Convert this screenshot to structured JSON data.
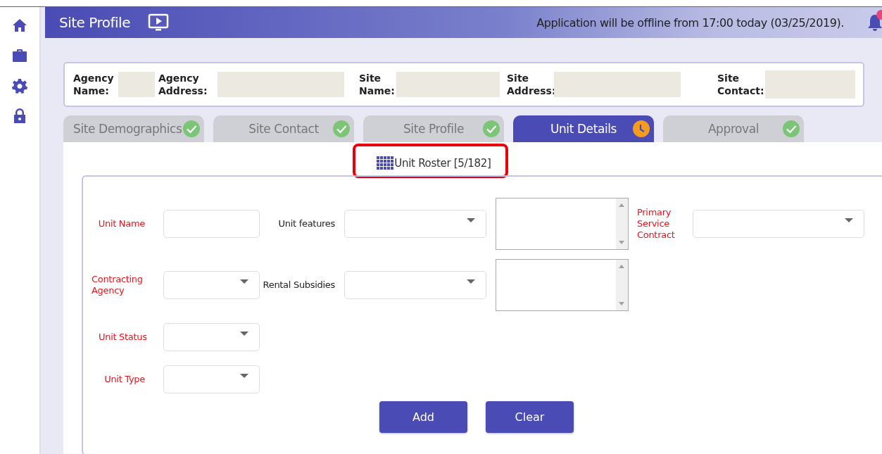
{
  "sidebar": {
    "items": [
      {
        "kind": "home"
      },
      {
        "kind": "briefcase"
      },
      {
        "kind": "gear"
      },
      {
        "kind": "lock"
      }
    ]
  },
  "header": {
    "title": "Site Profile",
    "notice": "Application will be offline from 17:00 today (03/25/2019)."
  },
  "info": [
    {
      "label": "Agency Name:"
    },
    {
      "label": "Agency Address:"
    },
    {
      "label": "Site Name:"
    },
    {
      "label": "Site Address:"
    },
    {
      "label": "Site Contact:"
    }
  ],
  "tabs": [
    {
      "label": "Site Demographics",
      "kind": "complete",
      "selected": false
    },
    {
      "label": "Site Contact",
      "kind": "complete",
      "selected": false
    },
    {
      "label": "Site Profile",
      "kind": "complete",
      "selected": false
    },
    {
      "label": "Unit Details",
      "kind": "pending",
      "selected": true
    },
    {
      "label": "Approval",
      "kind": "complete",
      "selected": false
    }
  ],
  "roster": {
    "label": "Unit Roster [5/182]",
    "highlighted": true
  },
  "form": {
    "rows": [
      [
        {
          "kind": "text",
          "label": "Unit Name",
          "required": true
        },
        {
          "kind": "select",
          "label": "Unit features",
          "required": false
        },
        {
          "kind": "textarea"
        },
        {
          "kind": "select",
          "label": "Primary Service Contract",
          "required": true
        }
      ],
      [
        {
          "kind": "select",
          "label": "Contracting Agency",
          "required": true
        },
        {
          "kind": "select",
          "label": "Rental Subsidies",
          "required": false
        },
        {
          "kind": "textarea"
        }
      ],
      [
        {
          "kind": "select",
          "label": "Unit Status",
          "required": true
        }
      ],
      [
        {
          "kind": "select",
          "label": "Unit Type",
          "required": true
        }
      ]
    ],
    "buttons": [
      "Add",
      "Clear"
    ]
  }
}
